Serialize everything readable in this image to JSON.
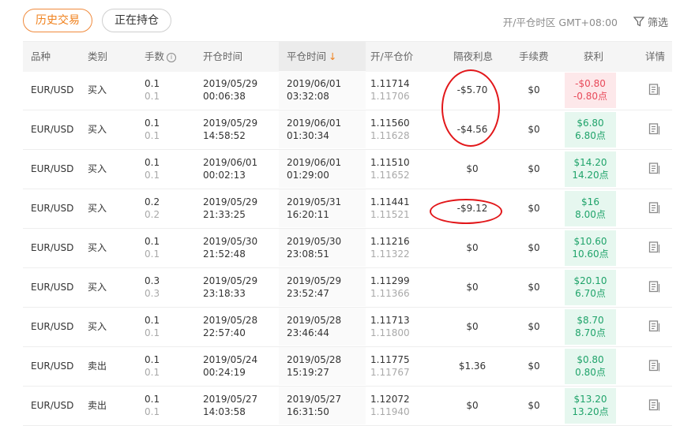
{
  "tabs": [
    {
      "label": "历史交易",
      "active": true
    },
    {
      "label": "正在持仓",
      "active": false
    }
  ],
  "timezone": "开/平仓时区 GMT+08:00",
  "filter_label": "筛选",
  "columns": {
    "symbol": "品种",
    "type": "类别",
    "lots": "手数",
    "open_time": "开仓时间",
    "close_time": "平仓时间",
    "price": "开/平仓价",
    "swap": "隔夜利息",
    "fee": "手续费",
    "profit": "获利",
    "detail": "详情"
  },
  "sort": {
    "column": "close_time",
    "direction": "desc"
  },
  "rows": [
    {
      "symbol": "EUR/USD",
      "type": "买入",
      "lots": "0.1",
      "lots_sub": "0.1",
      "open_date": "2019/05/29",
      "open_time": "00:06:38",
      "close_date": "2019/06/01",
      "close_time": "03:32:08",
      "open_price": "1.11714",
      "close_price": "1.11706",
      "swap": "-$5.70",
      "fee": "$0",
      "profit": "-$0.80",
      "points": "-0.80点",
      "status": "loss"
    },
    {
      "symbol": "EUR/USD",
      "type": "买入",
      "lots": "0.1",
      "lots_sub": "0.1",
      "open_date": "2019/05/29",
      "open_time": "14:58:52",
      "close_date": "2019/06/01",
      "close_time": "01:30:34",
      "open_price": "1.11560",
      "close_price": "1.11628",
      "swap": "-$4.56",
      "fee": "$0",
      "profit": "$6.80",
      "points": "6.80点",
      "status": "gain"
    },
    {
      "symbol": "EUR/USD",
      "type": "买入",
      "lots": "0.1",
      "lots_sub": "0.1",
      "open_date": "2019/06/01",
      "open_time": "00:02:13",
      "close_date": "2019/06/01",
      "close_time": "01:29:00",
      "open_price": "1.11510",
      "close_price": "1.11652",
      "swap": "$0",
      "fee": "$0",
      "profit": "$14.20",
      "points": "14.20点",
      "status": "gain"
    },
    {
      "symbol": "EUR/USD",
      "type": "买入",
      "lots": "0.2",
      "lots_sub": "0.2",
      "open_date": "2019/05/29",
      "open_time": "21:33:25",
      "close_date": "2019/05/31",
      "close_time": "16:20:11",
      "open_price": "1.11441",
      "close_price": "1.11521",
      "swap": "-$9.12",
      "fee": "$0",
      "profit": "$16",
      "points": "8.00点",
      "status": "gain"
    },
    {
      "symbol": "EUR/USD",
      "type": "买入",
      "lots": "0.1",
      "lots_sub": "0.1",
      "open_date": "2019/05/30",
      "open_time": "21:52:48",
      "close_date": "2019/05/30",
      "close_time": "23:08:51",
      "open_price": "1.11216",
      "close_price": "1.11322",
      "swap": "$0",
      "fee": "$0",
      "profit": "$10.60",
      "points": "10.60点",
      "status": "gain"
    },
    {
      "symbol": "EUR/USD",
      "type": "买入",
      "lots": "0.3",
      "lots_sub": "0.3",
      "open_date": "2019/05/29",
      "open_time": "23:18:33",
      "close_date": "2019/05/29",
      "close_time": "23:52:47",
      "open_price": "1.11299",
      "close_price": "1.11366",
      "swap": "$0",
      "fee": "$0",
      "profit": "$20.10",
      "points": "6.70点",
      "status": "gain"
    },
    {
      "symbol": "EUR/USD",
      "type": "买入",
      "lots": "0.1",
      "lots_sub": "0.1",
      "open_date": "2019/05/28",
      "open_time": "22:57:40",
      "close_date": "2019/05/28",
      "close_time": "23:46:44",
      "open_price": "1.11713",
      "close_price": "1.11800",
      "swap": "$0",
      "fee": "$0",
      "profit": "$8.70",
      "points": "8.70点",
      "status": "gain"
    },
    {
      "symbol": "EUR/USD",
      "type": "卖出",
      "lots": "0.1",
      "lots_sub": "0.1",
      "open_date": "2019/05/24",
      "open_time": "00:24:19",
      "close_date": "2019/05/28",
      "close_time": "15:19:27",
      "open_price": "1.11775",
      "close_price": "1.11767",
      "swap": "$1.36",
      "fee": "$0",
      "profit": "$0.80",
      "points": "0.80点",
      "status": "gain"
    },
    {
      "symbol": "EUR/USD",
      "type": "卖出",
      "lots": "0.1",
      "lots_sub": "0.1",
      "open_date": "2019/05/27",
      "open_time": "14:03:58",
      "close_date": "2019/05/27",
      "close_time": "16:31:50",
      "open_price": "1.12072",
      "close_price": "1.11940",
      "swap": "$0",
      "fee": "$0",
      "profit": "$13.20",
      "points": "13.20点",
      "status": "gain"
    }
  ],
  "colors": {
    "accent": "#f0821e",
    "gain_text": "#1fa36a",
    "gain_bg": "#e6f7ef",
    "loss_text": "#e84a5a",
    "loss_bg": "#fde8ea",
    "annotation": "#e2171a"
  },
  "icons": {
    "filter": "filter-icon",
    "detail": "document-icon",
    "info": "info-icon",
    "sort": "arrow-down-icon"
  }
}
